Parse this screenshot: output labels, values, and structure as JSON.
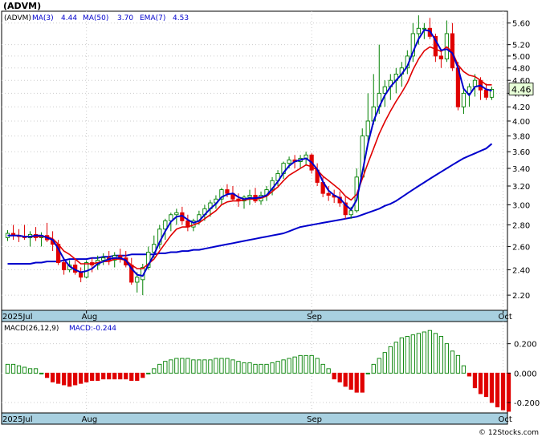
{
  "title": "(ADVM)",
  "legend": {
    "ma3_label": "MA(3)",
    "ma3_value": "4.44",
    "ma50_label": "MA(50)",
    "ma50_value": "3.70",
    "ema7_label": "EMA(7)",
    "ema7_value": "4.53"
  },
  "last_price_label": "4.46",
  "macd_legend": {
    "params": "MACD(26,12,9)",
    "value": "MACD:-0.244"
  },
  "watermark": "© 12Stocks.com",
  "colors": {
    "up": "#008000",
    "down": "#e00000",
    "ma_short": "#0000cc",
    "ma_long": "#0000cc",
    "ema": "#e00000",
    "axis_band": "#a8d0e0",
    "price_box": "#e8ffd8"
  },
  "chart_data": [
    {
      "type": "candlestick",
      "title": "(ADVM)",
      "x_labels": [
        "2025Jul",
        "Aug",
        "Sep",
        "Oct"
      ],
      "x_label_index": [
        0,
        14,
        54,
        88
      ],
      "y_ticks": [
        2.2,
        2.4,
        2.6,
        2.8,
        3.0,
        3.2,
        3.4,
        3.6,
        3.8,
        4.0,
        4.2,
        4.4,
        4.6,
        4.8,
        5.0,
        5.2,
        5.6
      ],
      "ylim": [
        2.1,
        5.8
      ],
      "scale": "log",
      "ohlc": [
        [
          2.68,
          2.75,
          2.65,
          2.72
        ],
        [
          2.72,
          2.8,
          2.66,
          2.7
        ],
        [
          2.7,
          2.76,
          2.64,
          2.69
        ],
        [
          2.69,
          2.8,
          2.66,
          2.68
        ],
        [
          2.68,
          2.74,
          2.6,
          2.71
        ],
        [
          2.71,
          2.78,
          2.65,
          2.68
        ],
        [
          2.68,
          2.73,
          2.6,
          2.7
        ],
        [
          2.7,
          2.82,
          2.64,
          2.66
        ],
        [
          2.66,
          2.74,
          2.56,
          2.62
        ],
        [
          2.62,
          2.66,
          2.44,
          2.46
        ],
        [
          2.46,
          2.5,
          2.36,
          2.4
        ],
        [
          2.4,
          2.48,
          2.38,
          2.44
        ],
        [
          2.44,
          2.48,
          2.36,
          2.38
        ],
        [
          2.38,
          2.42,
          2.3,
          2.34
        ],
        [
          2.34,
          2.48,
          2.33,
          2.46
        ],
        [
          2.46,
          2.5,
          2.38,
          2.44
        ],
        [
          2.44,
          2.52,
          2.4,
          2.48
        ],
        [
          2.48,
          2.54,
          2.44,
          2.5
        ],
        [
          2.5,
          2.56,
          2.44,
          2.48
        ],
        [
          2.48,
          2.55,
          2.42,
          2.52
        ],
        [
          2.52,
          2.58,
          2.46,
          2.5
        ],
        [
          2.5,
          2.56,
          2.42,
          2.44
        ],
        [
          2.44,
          2.5,
          2.28,
          2.3
        ],
        [
          2.3,
          2.38,
          2.22,
          2.34
        ],
        [
          2.32,
          2.45,
          2.2,
          2.42
        ],
        [
          2.42,
          2.6,
          2.4,
          2.55
        ],
        [
          2.55,
          2.7,
          2.5,
          2.62
        ],
        [
          2.62,
          2.8,
          2.58,
          2.76
        ],
        [
          2.76,
          2.86,
          2.66,
          2.84
        ],
        [
          2.84,
          2.92,
          2.74,
          2.9
        ],
        [
          2.9,
          2.96,
          2.8,
          2.92
        ],
        [
          2.92,
          2.98,
          2.8,
          2.84
        ],
        [
          2.84,
          2.9,
          2.74,
          2.78
        ],
        [
          2.78,
          2.86,
          2.74,
          2.84
        ],
        [
          2.84,
          2.94,
          2.8,
          2.9
        ],
        [
          2.9,
          3.0,
          2.84,
          2.96
        ],
        [
          2.96,
          3.05,
          2.88,
          3.02
        ],
        [
          3.02,
          3.1,
          2.96,
          3.06
        ],
        [
          3.06,
          3.18,
          3.0,
          3.16
        ],
        [
          3.16,
          3.22,
          3.08,
          3.12
        ],
        [
          3.12,
          3.2,
          3.04,
          3.06
        ],
        [
          3.06,
          3.12,
          2.98,
          3.04
        ],
        [
          3.04,
          3.1,
          2.96,
          3.08
        ],
        [
          3.08,
          3.16,
          3.0,
          3.1
        ],
        [
          3.1,
          3.18,
          3.02,
          3.04
        ],
        [
          3.04,
          3.14,
          3.0,
          3.1
        ],
        [
          3.1,
          3.2,
          3.04,
          3.16
        ],
        [
          3.16,
          3.3,
          3.1,
          3.26
        ],
        [
          3.26,
          3.38,
          3.2,
          3.34
        ],
        [
          3.34,
          3.48,
          3.28,
          3.46
        ],
        [
          3.46,
          3.54,
          3.4,
          3.5
        ],
        [
          3.5,
          3.56,
          3.4,
          3.48
        ],
        [
          3.48,
          3.56,
          3.4,
          3.52
        ],
        [
          3.52,
          3.6,
          3.44,
          3.56
        ],
        [
          3.56,
          3.58,
          3.34,
          3.38
        ],
        [
          3.38,
          3.46,
          3.2,
          3.24
        ],
        [
          3.24,
          3.3,
          3.08,
          3.12
        ],
        [
          3.12,
          3.2,
          3.04,
          3.1
        ],
        [
          3.1,
          3.16,
          3.02,
          3.08
        ],
        [
          3.08,
          3.14,
          2.98,
          3.02
        ],
        [
          3.02,
          3.08,
          2.86,
          2.9
        ],
        [
          2.9,
          2.98,
          2.86,
          2.94
        ],
        [
          2.94,
          3.4,
          2.92,
          3.3
        ],
        [
          3.3,
          3.9,
          3.28,
          3.8
        ],
        [
          3.8,
          4.4,
          3.7,
          4.0
        ],
        [
          4.0,
          4.7,
          3.95,
          4.2
        ],
        [
          4.2,
          5.2,
          4.1,
          4.4
        ],
        [
          4.4,
          4.6,
          4.2,
          4.5
        ],
        [
          4.5,
          4.7,
          4.3,
          4.6
        ],
        [
          4.6,
          4.8,
          4.4,
          4.7
        ],
        [
          4.7,
          4.9,
          4.5,
          4.8
        ],
        [
          4.8,
          5.1,
          4.7,
          5.0
        ],
        [
          5.0,
          5.6,
          4.9,
          5.4
        ],
        [
          5.4,
          5.75,
          5.2,
          5.5
        ],
        [
          5.5,
          5.6,
          5.3,
          5.5
        ],
        [
          5.5,
          5.7,
          5.3,
          5.35
        ],
        [
          5.35,
          5.4,
          4.9,
          5.0
        ],
        [
          5.0,
          5.1,
          4.8,
          4.95
        ],
        [
          4.95,
          5.65,
          4.9,
          5.4
        ],
        [
          5.4,
          5.6,
          4.75,
          4.8
        ],
        [
          4.8,
          4.9,
          4.15,
          4.2
        ],
        [
          4.2,
          4.5,
          4.1,
          4.4
        ],
        [
          4.4,
          4.55,
          4.2,
          4.5
        ],
        [
          4.5,
          4.7,
          4.35,
          4.6
        ],
        [
          4.6,
          4.65,
          4.3,
          4.45
        ],
        [
          4.45,
          4.55,
          4.3,
          4.34
        ],
        [
          4.34,
          4.5,
          4.3,
          4.46
        ]
      ],
      "ma3": [
        2.7,
        2.7,
        2.7,
        2.69,
        2.69,
        2.7,
        2.7,
        2.68,
        2.66,
        2.58,
        2.49,
        2.43,
        2.4,
        2.38,
        2.39,
        2.41,
        2.45,
        2.47,
        2.49,
        2.5,
        2.5,
        2.48,
        2.41,
        2.36,
        2.35,
        2.44,
        2.53,
        2.64,
        2.74,
        2.83,
        2.88,
        2.89,
        2.85,
        2.82,
        2.84,
        2.9,
        2.96,
        3.01,
        3.08,
        3.11,
        3.12,
        3.08,
        3.06,
        3.07,
        3.07,
        3.08,
        3.1,
        3.17,
        3.25,
        3.35,
        3.43,
        3.48,
        3.5,
        3.52,
        3.47,
        3.39,
        3.25,
        3.15,
        3.1,
        3.07,
        3.0,
        2.95,
        3.05,
        3.35,
        3.7,
        4.0,
        4.2,
        4.37,
        4.5,
        4.6,
        4.7,
        4.83,
        5.07,
        5.3,
        5.47,
        5.45,
        5.28,
        5.1,
        5.12,
        5.05,
        4.8,
        4.47,
        4.37,
        4.5,
        4.52,
        4.46,
        4.44
      ],
      "ema7": [
        2.7,
        2.7,
        2.7,
        2.69,
        2.69,
        2.69,
        2.69,
        2.69,
        2.67,
        2.62,
        2.56,
        2.53,
        2.49,
        2.45,
        2.45,
        2.45,
        2.46,
        2.47,
        2.47,
        2.49,
        2.49,
        2.48,
        2.44,
        2.41,
        2.41,
        2.45,
        2.49,
        2.56,
        2.63,
        2.7,
        2.76,
        2.78,
        2.78,
        2.8,
        2.82,
        2.86,
        2.9,
        2.94,
        3.0,
        3.03,
        3.04,
        3.04,
        3.05,
        3.06,
        3.06,
        3.07,
        3.09,
        3.14,
        3.19,
        3.26,
        3.32,
        3.36,
        3.4,
        3.44,
        3.42,
        3.38,
        3.31,
        3.26,
        3.21,
        3.16,
        3.09,
        3.05,
        3.11,
        3.28,
        3.46,
        3.64,
        3.83,
        3.99,
        4.14,
        4.28,
        4.41,
        4.56,
        4.77,
        4.95,
        5.09,
        5.16,
        5.12,
        5.08,
        5.16,
        5.07,
        4.85,
        4.74,
        4.68,
        4.66,
        4.6,
        4.53,
        4.53
      ],
      "ma50": [
        2.45,
        2.45,
        2.45,
        2.45,
        2.45,
        2.46,
        2.46,
        2.47,
        2.47,
        2.47,
        2.48,
        2.49,
        2.49,
        2.49,
        2.49,
        2.5,
        2.5,
        2.51,
        2.51,
        2.52,
        2.52,
        2.52,
        2.53,
        2.53,
        2.53,
        2.53,
        2.53,
        2.54,
        2.54,
        2.55,
        2.55,
        2.56,
        2.56,
        2.57,
        2.57,
        2.58,
        2.59,
        2.6,
        2.61,
        2.62,
        2.63,
        2.64,
        2.65,
        2.66,
        2.67,
        2.68,
        2.69,
        2.7,
        2.71,
        2.72,
        2.74,
        2.76,
        2.78,
        2.79,
        2.8,
        2.81,
        2.82,
        2.83,
        2.84,
        2.85,
        2.86,
        2.87,
        2.88,
        2.9,
        2.92,
        2.94,
        2.96,
        2.99,
        3.01,
        3.04,
        3.08,
        3.12,
        3.16,
        3.2,
        3.24,
        3.28,
        3.32,
        3.36,
        3.4,
        3.44,
        3.48,
        3.52,
        3.55,
        3.58,
        3.61,
        3.64,
        3.7
      ]
    },
    {
      "type": "bar",
      "title": "MACD(26,12,9)",
      "y_ticks": [
        0.2,
        0.0,
        -0.2
      ],
      "ylim": [
        -0.26,
        0.34
      ],
      "values": [
        0.06,
        0.06,
        0.05,
        0.04,
        0.03,
        0.03,
        0.0,
        -0.03,
        -0.06,
        -0.07,
        -0.08,
        -0.09,
        -0.08,
        -0.07,
        -0.06,
        -0.05,
        -0.05,
        -0.04,
        -0.04,
        -0.04,
        -0.04,
        -0.04,
        -0.05,
        -0.05,
        -0.03,
        0.0,
        0.03,
        0.06,
        0.08,
        0.09,
        0.1,
        0.1,
        0.1,
        0.09,
        0.09,
        0.09,
        0.09,
        0.1,
        0.1,
        0.1,
        0.09,
        0.08,
        0.07,
        0.07,
        0.06,
        0.06,
        0.06,
        0.07,
        0.08,
        0.09,
        0.1,
        0.11,
        0.12,
        0.12,
        0.12,
        0.1,
        0.06,
        0.03,
        -0.04,
        -0.06,
        -0.09,
        -0.11,
        -0.13,
        -0.13,
        0.0,
        0.06,
        0.1,
        0.14,
        0.18,
        0.21,
        0.24,
        0.25,
        0.26,
        0.27,
        0.28,
        0.29,
        0.27,
        0.25,
        0.2,
        0.15,
        0.12,
        0.05,
        -0.02,
        -0.1,
        -0.14,
        -0.16,
        -0.2,
        -0.23,
        -0.25,
        -0.26
      ]
    }
  ]
}
